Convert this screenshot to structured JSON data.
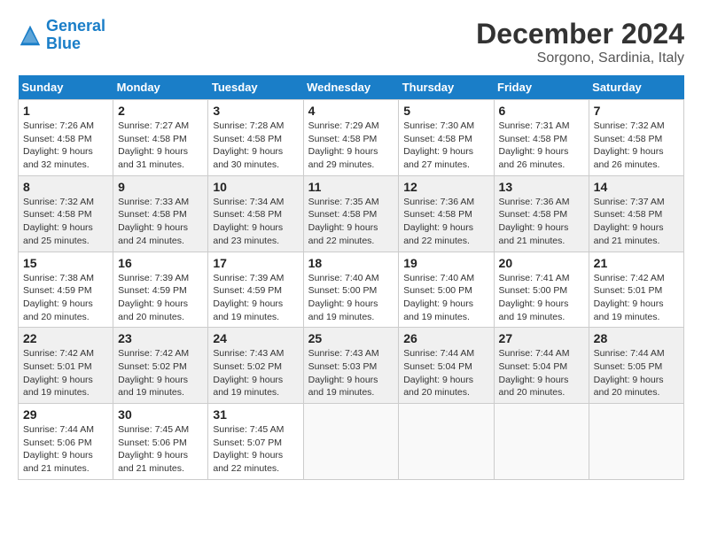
{
  "logo": {
    "line1": "General",
    "line2": "Blue"
  },
  "title": "December 2024",
  "location": "Sorgono, Sardinia, Italy",
  "weekdays": [
    "Sunday",
    "Monday",
    "Tuesday",
    "Wednesday",
    "Thursday",
    "Friday",
    "Saturday"
  ],
  "weeks": [
    [
      {
        "day": "1",
        "rise": "7:26 AM",
        "set": "4:58 PM",
        "hours": "9 hours and 32 minutes."
      },
      {
        "day": "2",
        "rise": "7:27 AM",
        "set": "4:58 PM",
        "hours": "9 hours and 31 minutes."
      },
      {
        "day": "3",
        "rise": "7:28 AM",
        "set": "4:58 PM",
        "hours": "9 hours and 30 minutes."
      },
      {
        "day": "4",
        "rise": "7:29 AM",
        "set": "4:58 PM",
        "hours": "9 hours and 29 minutes."
      },
      {
        "day": "5",
        "rise": "7:30 AM",
        "set": "4:58 PM",
        "hours": "9 hours and 27 minutes."
      },
      {
        "day": "6",
        "rise": "7:31 AM",
        "set": "4:58 PM",
        "hours": "9 hours and 26 minutes."
      },
      {
        "day": "7",
        "rise": "7:32 AM",
        "set": "4:58 PM",
        "hours": "9 hours and 26 minutes."
      }
    ],
    [
      {
        "day": "8",
        "rise": "7:32 AM",
        "set": "4:58 PM",
        "hours": "9 hours and 25 minutes."
      },
      {
        "day": "9",
        "rise": "7:33 AM",
        "set": "4:58 PM",
        "hours": "9 hours and 24 minutes."
      },
      {
        "day": "10",
        "rise": "7:34 AM",
        "set": "4:58 PM",
        "hours": "9 hours and 23 minutes."
      },
      {
        "day": "11",
        "rise": "7:35 AM",
        "set": "4:58 PM",
        "hours": "9 hours and 22 minutes."
      },
      {
        "day": "12",
        "rise": "7:36 AM",
        "set": "4:58 PM",
        "hours": "9 hours and 22 minutes."
      },
      {
        "day": "13",
        "rise": "7:36 AM",
        "set": "4:58 PM",
        "hours": "9 hours and 21 minutes."
      },
      {
        "day": "14",
        "rise": "7:37 AM",
        "set": "4:58 PM",
        "hours": "9 hours and 21 minutes."
      }
    ],
    [
      {
        "day": "15",
        "rise": "7:38 AM",
        "set": "4:59 PM",
        "hours": "9 hours and 20 minutes."
      },
      {
        "day": "16",
        "rise": "7:39 AM",
        "set": "4:59 PM",
        "hours": "9 hours and 20 minutes."
      },
      {
        "day": "17",
        "rise": "7:39 AM",
        "set": "4:59 PM",
        "hours": "9 hours and 19 minutes."
      },
      {
        "day": "18",
        "rise": "7:40 AM",
        "set": "5:00 PM",
        "hours": "9 hours and 19 minutes."
      },
      {
        "day": "19",
        "rise": "7:40 AM",
        "set": "5:00 PM",
        "hours": "9 hours and 19 minutes."
      },
      {
        "day": "20",
        "rise": "7:41 AM",
        "set": "5:00 PM",
        "hours": "9 hours and 19 minutes."
      },
      {
        "day": "21",
        "rise": "7:42 AM",
        "set": "5:01 PM",
        "hours": "9 hours and 19 minutes."
      }
    ],
    [
      {
        "day": "22",
        "rise": "7:42 AM",
        "set": "5:01 PM",
        "hours": "9 hours and 19 minutes."
      },
      {
        "day": "23",
        "rise": "7:42 AM",
        "set": "5:02 PM",
        "hours": "9 hours and 19 minutes."
      },
      {
        "day": "24",
        "rise": "7:43 AM",
        "set": "5:02 PM",
        "hours": "9 hours and 19 minutes."
      },
      {
        "day": "25",
        "rise": "7:43 AM",
        "set": "5:03 PM",
        "hours": "9 hours and 19 minutes."
      },
      {
        "day": "26",
        "rise": "7:44 AM",
        "set": "5:04 PM",
        "hours": "9 hours and 20 minutes."
      },
      {
        "day": "27",
        "rise": "7:44 AM",
        "set": "5:04 PM",
        "hours": "9 hours and 20 minutes."
      },
      {
        "day": "28",
        "rise": "7:44 AM",
        "set": "5:05 PM",
        "hours": "9 hours and 20 minutes."
      }
    ],
    [
      {
        "day": "29",
        "rise": "7:44 AM",
        "set": "5:06 PM",
        "hours": "9 hours and 21 minutes."
      },
      {
        "day": "30",
        "rise": "7:45 AM",
        "set": "5:06 PM",
        "hours": "9 hours and 21 minutes."
      },
      {
        "day": "31",
        "rise": "7:45 AM",
        "set": "5:07 PM",
        "hours": "9 hours and 22 minutes."
      },
      null,
      null,
      null,
      null
    ]
  ],
  "labels": {
    "sunrise": "Sunrise:",
    "sunset": "Sunset:",
    "daylight": "Daylight:"
  }
}
